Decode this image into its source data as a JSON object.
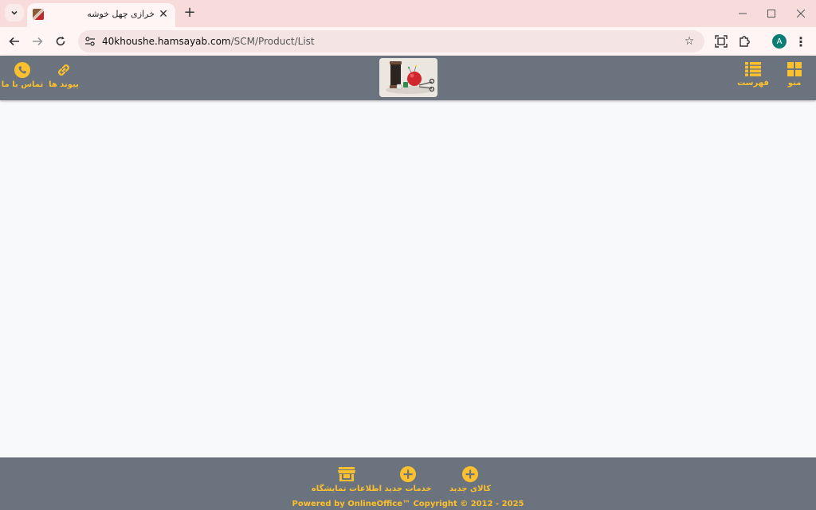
{
  "browser": {
    "tab": {
      "title": "خرازی چهل خوشه",
      "close_label": "✕"
    },
    "new_tab_label": "+",
    "url_host": "40khoushe.hamsayab.com",
    "url_path": "/SCM/Product/List",
    "profile_initial": "A"
  },
  "header": {
    "menu_label": "منو",
    "list_label": "فهرست",
    "links_label": "پیوند ها",
    "contact_label": "تماس با ما"
  },
  "footer": {
    "new_product_label": "کالای جدید",
    "new_service_label": "خدمات جدید",
    "store_info_label": "اطلاعات نمایشگاه",
    "copyright": "Powered by OnlineOffice™ Copyright © 2012 - 2025"
  },
  "colors": {
    "accent": "#fbc02d",
    "bar": "#6b737e",
    "chrome": "#f8dcdc"
  }
}
